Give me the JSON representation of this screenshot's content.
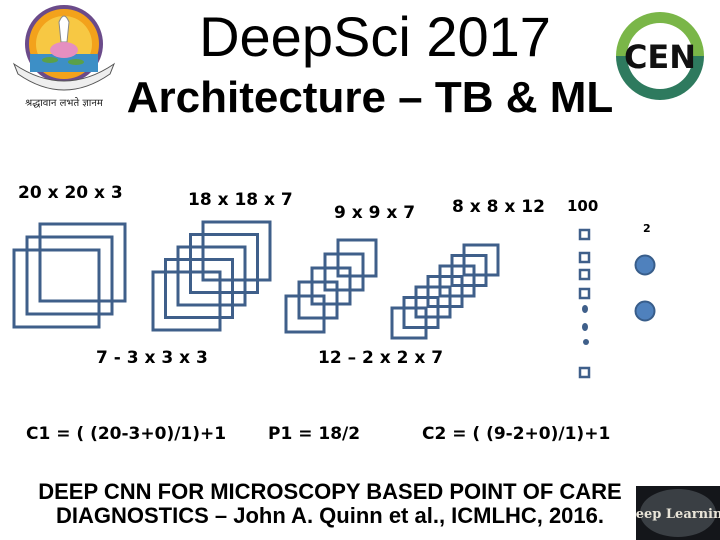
{
  "header": {
    "title": "DeepSci 2017",
    "subtitle": "Architecture – TB & ML",
    "left_logo": {
      "icon": "university-emblem-icon",
      "motto": "श्रद्धावान लभते ज्ञानम"
    },
    "right_logo": {
      "icon": "cen-logo-icon",
      "text": "CEN",
      "colors": {
        "top": "#7ab648",
        "bottom": "#2e7a5e"
      }
    }
  },
  "diagram": {
    "layers": [
      {
        "label": "20 x 20 x 3",
        "squares": 3
      },
      {
        "label": "18 x 18 x 7",
        "squares": 5
      },
      {
        "label": "9 x 9 x 7",
        "squares": 5
      },
      {
        "label": "8 x 8 x 12",
        "squares": 7
      },
      {
        "label": "100",
        "type": "dense"
      },
      {
        "label": "2",
        "type": "output"
      }
    ],
    "kernels": [
      {
        "label": "7 - 3 x 3 x 3"
      },
      {
        "label": "12 – 2 x 2 x 7"
      }
    ],
    "formulas": [
      {
        "label": "C1 = ( (20-3+0)/1)+1"
      },
      {
        "label": "P1 = 18/2"
      },
      {
        "label": "C2 = ( (9-2+0)/1)+1"
      }
    ],
    "colors": {
      "stroke": "#3f5f8a",
      "node_fill": "#4f81bd",
      "node_stroke": "#385d8a"
    }
  },
  "footer": {
    "line1": "DEEP CNN FOR MICROSCOPY BASED POINT OF CARE",
    "line2": "DIAGNOSTICS – John A. Quinn et al., ICMLHC, 2016.",
    "thumbnail": {
      "icon": "deep-learning-wordcloud-icon",
      "text": "Deep Learning"
    }
  }
}
